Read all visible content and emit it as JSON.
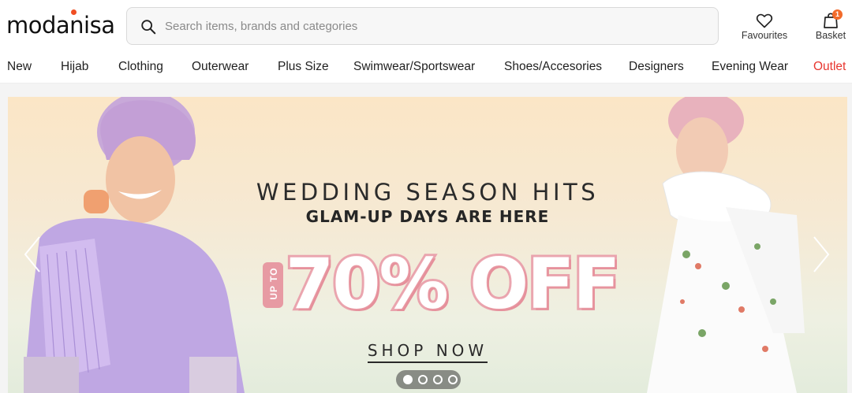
{
  "header": {
    "logo": "modanisa",
    "search": {
      "placeholder": "Search items, brands and categories",
      "value": ""
    },
    "favourites_label": "Favourites",
    "basket_label": "Basket",
    "basket_count": "1"
  },
  "nav": {
    "items": [
      {
        "label": "New"
      },
      {
        "label": "Hijab"
      },
      {
        "label": "Clothing"
      },
      {
        "label": "Outerwear"
      },
      {
        "label": "Plus Size"
      },
      {
        "label": "Swimwear/Sportswear"
      },
      {
        "label": "Shoes/Accesories"
      },
      {
        "label": "Designers"
      },
      {
        "label": "Evening Wear"
      },
      {
        "label": "Outlet"
      }
    ]
  },
  "banner": {
    "headline": "WEDDING SEASON HITS",
    "subheadline": "GLAM-UP DAYS ARE HERE",
    "offer_prefix": "UP TO",
    "offer": "70% OFF",
    "cta": "SHOP NOW",
    "slides_total": 4,
    "active_slide": 1
  },
  "icons": {
    "search": "search-icon",
    "favourites": "heart-icon",
    "basket": "shopping-bag-icon",
    "prev": "chevron-left-icon",
    "next": "chevron-right-icon"
  },
  "colors": {
    "brand_accent": "#f04e23",
    "outlet": "#e8362f",
    "badge": "#f26b2b",
    "offer_pink": "#e9a3ad"
  }
}
